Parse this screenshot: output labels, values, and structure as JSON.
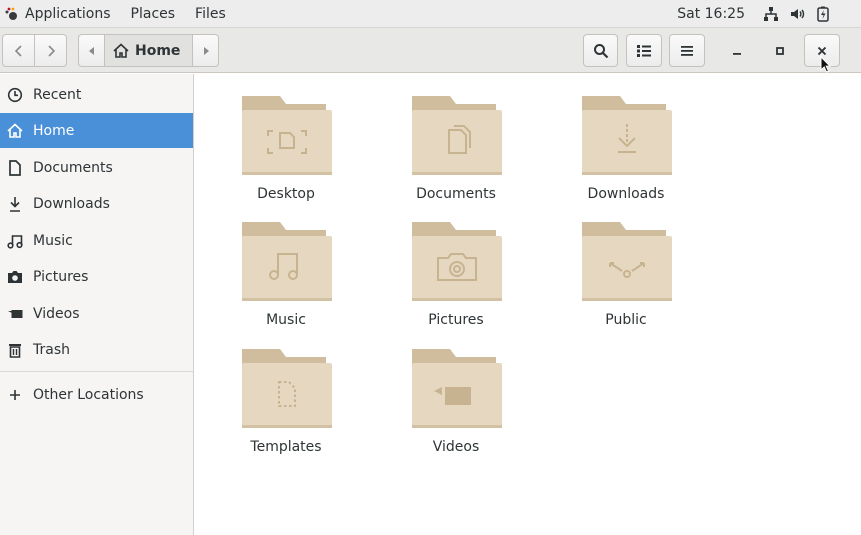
{
  "topbar": {
    "applications": "Applications",
    "places": "Places",
    "files": "Files",
    "clock": "Sat 16:25",
    "icons": [
      "network-icon",
      "volume-icon",
      "battery-icon"
    ]
  },
  "headerbar": {
    "path_current": "Home",
    "icons": [
      "back-icon",
      "forward-icon",
      "search-icon",
      "view-toggle-icon",
      "menu-icon",
      "minimize-icon",
      "maximize-icon",
      "close-icon"
    ]
  },
  "sidebar": {
    "items": [
      {
        "label": "Recent",
        "icon": "clock-icon",
        "active": false
      },
      {
        "label": "Home",
        "icon": "home-icon",
        "active": true
      },
      {
        "label": "Documents",
        "icon": "document-icon",
        "active": false
      },
      {
        "label": "Downloads",
        "icon": "download-icon",
        "active": false
      },
      {
        "label": "Music",
        "icon": "music-icon",
        "active": false
      },
      {
        "label": "Pictures",
        "icon": "camera-icon",
        "active": false
      },
      {
        "label": "Videos",
        "icon": "video-icon",
        "active": false
      },
      {
        "label": "Trash",
        "icon": "trash-icon",
        "active": false
      }
    ],
    "other_locations": "Other Locations"
  },
  "folders": [
    {
      "label": "Desktop",
      "emblem": "desktop"
    },
    {
      "label": "Documents",
      "emblem": "documents"
    },
    {
      "label": "Downloads",
      "emblem": "downloads"
    },
    {
      "label": "Music",
      "emblem": "music"
    },
    {
      "label": "Pictures",
      "emblem": "pictures"
    },
    {
      "label": "Public",
      "emblem": "public"
    },
    {
      "label": "Templates",
      "emblem": "templates"
    },
    {
      "label": "Videos",
      "emblem": "videos"
    }
  ],
  "colors": {
    "accent": "#4a90d9",
    "folder_body": "#e6d8c0",
    "folder_tab": "#cfbd9e",
    "folder_emblem": "#c7b390"
  }
}
